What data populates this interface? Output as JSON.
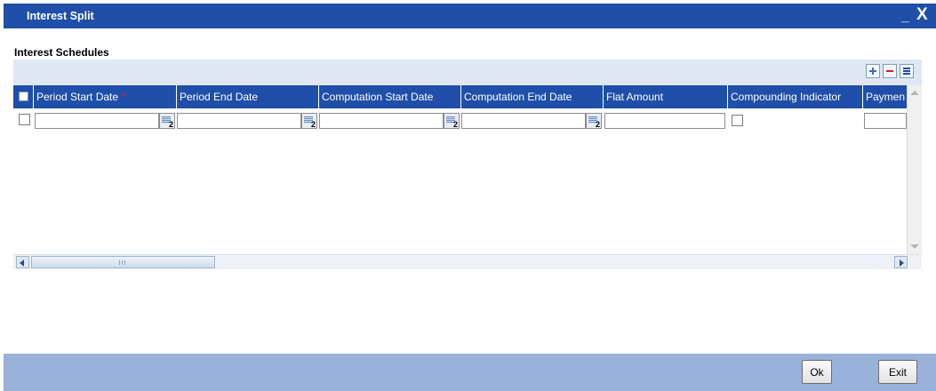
{
  "window": {
    "title": "Interest Split",
    "minimize_label": "_",
    "close_label": "X"
  },
  "section": {
    "label": "Interest Schedules"
  },
  "toolbar": {
    "add_icon": "plus-icon",
    "delete_icon": "minus-icon",
    "list_icon": "list-view-icon"
  },
  "table": {
    "columns": [
      {
        "label": "Period Start Date",
        "required": true
      },
      {
        "label": "Period End Date",
        "required": false
      },
      {
        "label": "Computation Start Date",
        "required": false
      },
      {
        "label": "Computation End Date",
        "required": false
      },
      {
        "label": "Flat Amount",
        "required": false
      },
      {
        "label": "Compounding Indicator",
        "required": false
      },
      {
        "label": "Paymen",
        "required": false
      }
    ],
    "required_marker": "*",
    "rows": [
      {
        "selected": false,
        "period_start_date": "",
        "period_end_date": "",
        "computation_start_date": "",
        "computation_end_date": "",
        "flat_amount": "",
        "compounding_indicator": false,
        "payment": ""
      }
    ]
  },
  "footer": {
    "ok_label": "Ok",
    "exit_label": "Exit"
  },
  "colors": {
    "title_bar": "#1f4fa8",
    "header_row": "#1f4fa8",
    "footer": "#9ab1d9",
    "toolbar_strip": "#dfe8f3",
    "required": "#e31b1b"
  }
}
